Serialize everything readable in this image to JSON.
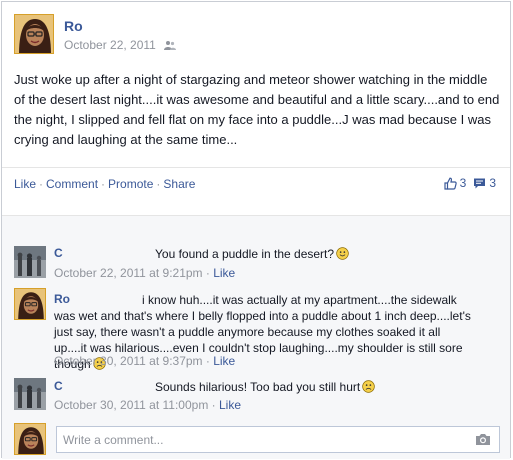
{
  "post": {
    "author": "Ro",
    "date": "October 22, 2011",
    "text": "Just woke up after a night of stargazing and meteor shower watching in the middle of the desert last night....it was awesome and beautiful and a little scary....and to end the night, I slipped and fell flat on my face into a puddle...J was mad because I was crying and laughing at the same time...",
    "audience_icon": "friends-icon"
  },
  "actions": {
    "like": "Like",
    "comment": "Comment",
    "promote": "Promote",
    "share": "Share",
    "separator": "·",
    "like_count": "3",
    "comment_count": "3"
  },
  "comments": [
    {
      "name": "C",
      "text": "You found a puddle in the desert?",
      "emoji": "smile",
      "date": "October 22, 2011 at 9:21pm",
      "like": "Like"
    },
    {
      "name": "Ro",
      "text": "i know huh....it was actually at my apartment....the sidewalk was wet and that's where I belly flopped into a puddle about 1 inch deep....let's just say, there wasn't a puddle anymore because my clothes soaked it all up....it was hilarious....even I couldn't stop laughing....my shoulder is still sore though",
      "emoji": "frown",
      "date": "October 30, 2011 at 9:37pm",
      "like": "Like"
    },
    {
      "name": "C",
      "text": "Sounds hilarious! Too bad you still hurt",
      "emoji": "frown",
      "date": "October 30, 2011 at 11:00pm",
      "like": "Like"
    }
  ],
  "composer": {
    "placeholder": "Write a comment..."
  },
  "colors": {
    "link": "#3b5998",
    "meta": "#90949c",
    "comment_bg": "#f6f7f9"
  }
}
